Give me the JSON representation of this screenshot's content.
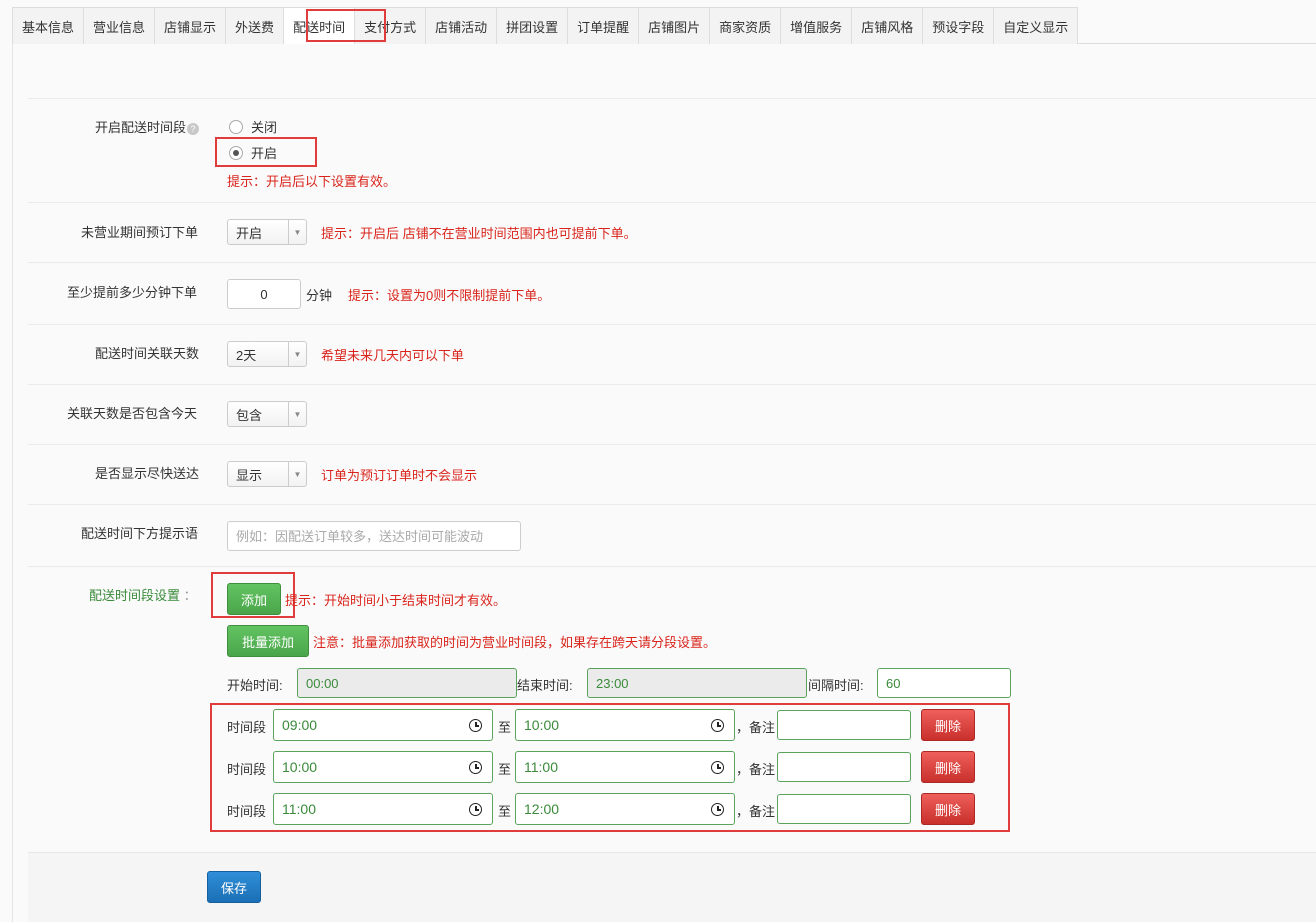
{
  "tabs": [
    "基本信息",
    "营业信息",
    "店铺显示",
    "外送费",
    "配送时间",
    "支付方式",
    "店铺活动",
    "拼团设置",
    "订单提醒",
    "店铺图片",
    "商家资质",
    "增值服务",
    "店铺风格",
    "预设字段",
    "自定义显示"
  ],
  "active_tab": "配送时间",
  "enable_period": {
    "label": "开启配送时间段",
    "help": "?",
    "off": "关闭",
    "on": "开启",
    "selected": "开启",
    "hint": "提示：开启后以下设置有效。"
  },
  "preorder": {
    "label": "未营业期间预订下单",
    "value": "开启",
    "hint": "提示：开启后 店铺不在营业时间范围内也可提前下单。"
  },
  "min_minutes": {
    "label": "至少提前多少分钟下单",
    "value": "0",
    "unit": "分钟",
    "hint": "提示：设置为0则不限制提前下单。"
  },
  "days": {
    "label": "配送时间关联天数",
    "value": "2天",
    "hint": "希望未来几天内可以下单"
  },
  "include_today": {
    "label": "关联天数是否包含今天",
    "value": "包含"
  },
  "asap": {
    "label": "是否显示尽快送达",
    "value": "显示",
    "hint": "订单为预订订单时不会显示"
  },
  "tip_text": {
    "label": "配送时间下方提示语",
    "placeholder": "例如：因配送订单较多，送达时间可能波动"
  },
  "periods": {
    "label": "配送时间段设置",
    "colon": "：",
    "add_label": "添加",
    "add_hint": "提示：开始时间小于结束时间才有效。",
    "batch_label": "批量添加",
    "batch_hint": "注意：批量添加获取的时间为营业时间段，如果存在跨天请分段设置。",
    "start_label": "开始时间:",
    "start_value": "00:00",
    "end_label": "结束时间:",
    "end_value": "23:00",
    "interval_label": "间隔时间:",
    "interval_value": "60",
    "row_label": "时间段",
    "to_label": "至",
    "note_label": "，备注",
    "delete_label": "删除",
    "rows": [
      {
        "from": "09:00",
        "to": "10:00",
        "note": ""
      },
      {
        "from": "10:00",
        "to": "11:00",
        "note": ""
      },
      {
        "from": "11:00",
        "to": "12:00",
        "note": ""
      }
    ]
  },
  "save_label": "保存",
  "colors": {
    "hint_red": "#d9241b",
    "highlight_red": "#e03c3c",
    "button_green": "#4aa54a",
    "button_red": "#c9302c",
    "button_blue": "#1b6fb5"
  }
}
